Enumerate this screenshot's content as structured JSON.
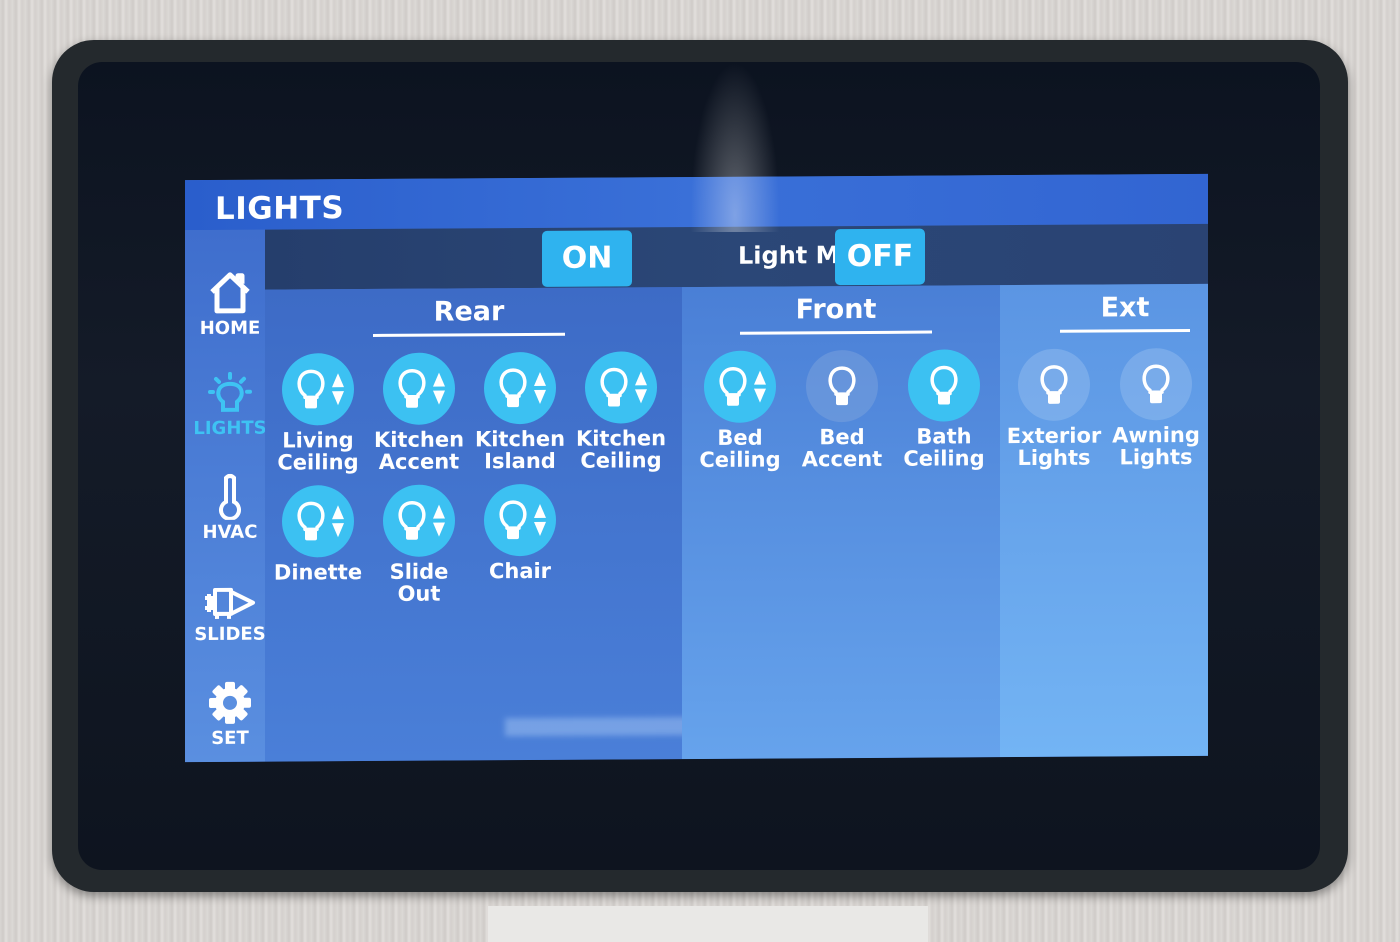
{
  "header": {
    "title": "LIGHTS"
  },
  "sidebar": {
    "items": [
      {
        "label": "HOME",
        "icon": "home-icon",
        "active": false
      },
      {
        "label": "LIGHTS",
        "icon": "lightbulb-icon",
        "active": true
      },
      {
        "label": "HVAC",
        "icon": "thermometer-icon",
        "active": false
      },
      {
        "label": "SLIDES",
        "icon": "slide-out-icon",
        "active": false
      },
      {
        "label": "SET",
        "icon": "gear-icon",
        "active": false
      }
    ]
  },
  "master": {
    "on_label": "ON",
    "label": "Light Master",
    "off_label": "OFF"
  },
  "colors": {
    "accent": "#2fb3ef",
    "title_bar": "#2a5ecc",
    "light_on": "#3cc1f2",
    "active_nav": "#3ec3f3"
  },
  "zones": [
    {
      "name": "Rear",
      "lights": [
        {
          "line1": "Living",
          "line2": "Ceiling",
          "state": "on",
          "dimmable": true
        },
        {
          "line1": "Kitchen",
          "line2": "Accent",
          "state": "on",
          "dimmable": true
        },
        {
          "line1": "Kitchen",
          "line2": "Island",
          "state": "on",
          "dimmable": true
        },
        {
          "line1": "Kitchen",
          "line2": "Ceiling",
          "state": "on",
          "dimmable": true
        },
        {
          "line1": "Dinette",
          "line2": "",
          "state": "on",
          "dimmable": true
        },
        {
          "line1": "Slide",
          "line2": "Out",
          "state": "on",
          "dimmable": true
        },
        {
          "line1": "Chair",
          "line2": "",
          "state": "on",
          "dimmable": true
        }
      ]
    },
    {
      "name": "Front",
      "lights": [
        {
          "line1": "Bed",
          "line2": "Ceiling",
          "state": "on",
          "dimmable": true
        },
        {
          "line1": "Bed",
          "line2": "Accent",
          "state": "off",
          "dimmable": false
        },
        {
          "line1": "Bath",
          "line2": "Ceiling",
          "state": "on",
          "dimmable": false
        }
      ]
    },
    {
      "name": "Ext",
      "lights": [
        {
          "line1": "Exterior",
          "line2": "Lights",
          "state": "off",
          "dimmable": false
        },
        {
          "line1": "Awning",
          "line2": "Lights",
          "state": "off",
          "dimmable": false
        }
      ]
    }
  ]
}
